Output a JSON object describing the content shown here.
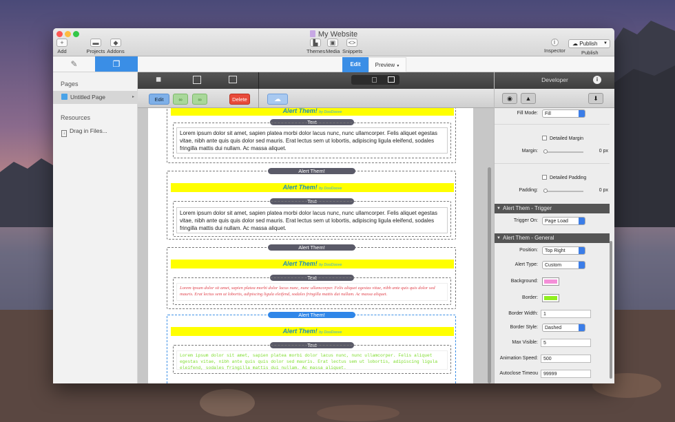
{
  "window": {
    "title": "My Website"
  },
  "toolbar": {
    "add": "Add",
    "projects": "Projects",
    "addons": "Addons",
    "themes": "Themes",
    "media": "Media",
    "snippets": "Snippets",
    "inspector": "Inspector",
    "publish_button": "Publish",
    "publish": "Publish"
  },
  "mode_tabs": {
    "edit": "Edit",
    "preview": "Preview"
  },
  "sidebar": {
    "pages_heading": "Pages",
    "page_item": "Untitled Page",
    "resources_heading": "Resources",
    "drag_item": "Drag in Files..."
  },
  "edit_toolbar": {
    "edit": "Edit",
    "delete": "Delete"
  },
  "content": {
    "alert_label": "Alert Them!",
    "alert_byline": "by DooDoove",
    "text_label": "Text",
    "lorem": "Lorem ipsum dolor sit amet, sapien platea morbi dolor lacus nunc, nunc ullamcorper. Felis aliquet egestas vitae, nibh ante quis quis dolor sed mauris. Erat lectus sem ut lobortis, adipiscing ligula eleifend, sodales fringilla mattis dui nullam. Ac massa aliquet."
  },
  "inspector": {
    "header": "Developer",
    "fill_mode_label": "Fill Mode:",
    "fill_mode_value": "Fill",
    "detailed_margin": "Detailed Margin",
    "margin_label": "Margin:",
    "margin_value": "0 px",
    "detailed_padding": "Detailed Padding",
    "padding_label": "Padding:",
    "padding_value": "0 px",
    "trigger_section": "Alert Them - Trigger",
    "trigger_on_label": "Trigger On:",
    "trigger_on_value": "Page Load",
    "general_section": "Alert Them - General",
    "position_label": "Position:",
    "position_value": "Top Right",
    "alert_type_label": "Alert Type:",
    "alert_type_value": "Custom",
    "background_label": "Background:",
    "background_color": "#f48fd8",
    "border_label": "Border:",
    "border_color": "#90ee20",
    "border_width_label": "Border Width:",
    "border_width_value": "1",
    "border_style_label": "Border Style:",
    "border_style_value": "Dashed",
    "max_visible_label": "Max Visible:",
    "max_visible_value": "5",
    "anim_speed_label": "Animation Speed:",
    "anim_speed_value": "500",
    "autoclose_label": "Autoclose Timeou",
    "autoclose_value": "99999"
  }
}
